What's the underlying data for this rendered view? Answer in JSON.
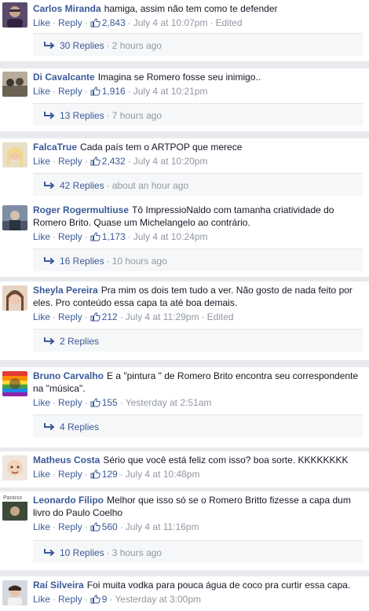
{
  "ui": {
    "like_label": "Like",
    "reply_label": "Reply",
    "sep": "·"
  },
  "comments": [
    {
      "author": "Carlos Miranda",
      "text": "hamiga, assim não tem como te defender",
      "likes": "2,843",
      "time": "July 4 at 10:07pm",
      "edited": "Edited",
      "replies": "30 Replies",
      "replies_time": "2 hours ago"
    },
    {
      "author": "Di Cavalcante",
      "text": "Imagina se Romero fosse seu inimigo..",
      "likes": "1,916",
      "time": "July 4 at 10:21pm",
      "edited": "",
      "replies": "13 Replies",
      "replies_time": "7 hours ago"
    },
    {
      "author": "FalcaTrue",
      "text": "Cada país tem o ARTPOP que merece",
      "likes": "2,432",
      "time": "July 4 at 10:20pm",
      "edited": "",
      "replies": "42 Replies",
      "replies_time": "about an hour ago"
    },
    {
      "author": "Roger Rogermultiuse",
      "text": "Tô ImpressioNaldo com tamanha criatividade do Romero Brito. Quase um Michelangelo ao contrário.",
      "likes": "1,173",
      "time": "July 4 at 10:24pm",
      "edited": "",
      "replies": "16 Replies",
      "replies_time": "10 hours ago"
    },
    {
      "author": "Sheyla Pereira",
      "text": "Pra mim os dois tem tudo a ver. Não gosto de nada feito por eles. Pro conteúdo essa capa ta até boa demais.",
      "likes": "212",
      "time": "July 4 at 11:29pm",
      "edited": "Edited",
      "replies": "2 Replies",
      "replies_time": ""
    },
    {
      "author": "Bruno Carvalho",
      "text": "E a \"pintura \" de Romero Brito encontra seu correspondente na \"música\".",
      "likes": "155",
      "time": "Yesterday at 2:51am",
      "edited": "",
      "replies": "4 Replies",
      "replies_time": ""
    },
    {
      "author": "Matheus Costa",
      "text": "Sério que você está feliz com isso? boa sorte. KKKKKKKK",
      "likes": "129",
      "time": "July 4 at 10:48pm",
      "edited": "",
      "replies": "",
      "replies_time": ""
    },
    {
      "author": "Leonardo Filipo",
      "text": "Melhor que isso só se o Romero Britto fizesse a capa dum livro do Paulo Coelho",
      "likes": "560",
      "time": "July 4 at 11:16pm",
      "edited": "",
      "replies": "10 Replies",
      "replies_time": "3 hours ago"
    },
    {
      "author": "Raí Silveira",
      "text": "Foi muita vodka para pouca água de coco pra curtir essa capa.",
      "likes": "9",
      "time": "Yesterday at 3:00pm",
      "edited": "",
      "replies": "",
      "replies_time": ""
    }
  ],
  "avatar_labels": {
    "leonardo": "Paraíso"
  },
  "colors": {
    "link": "#3b5998",
    "meta": "#9197a3",
    "page_bg": "#e9eaed"
  }
}
